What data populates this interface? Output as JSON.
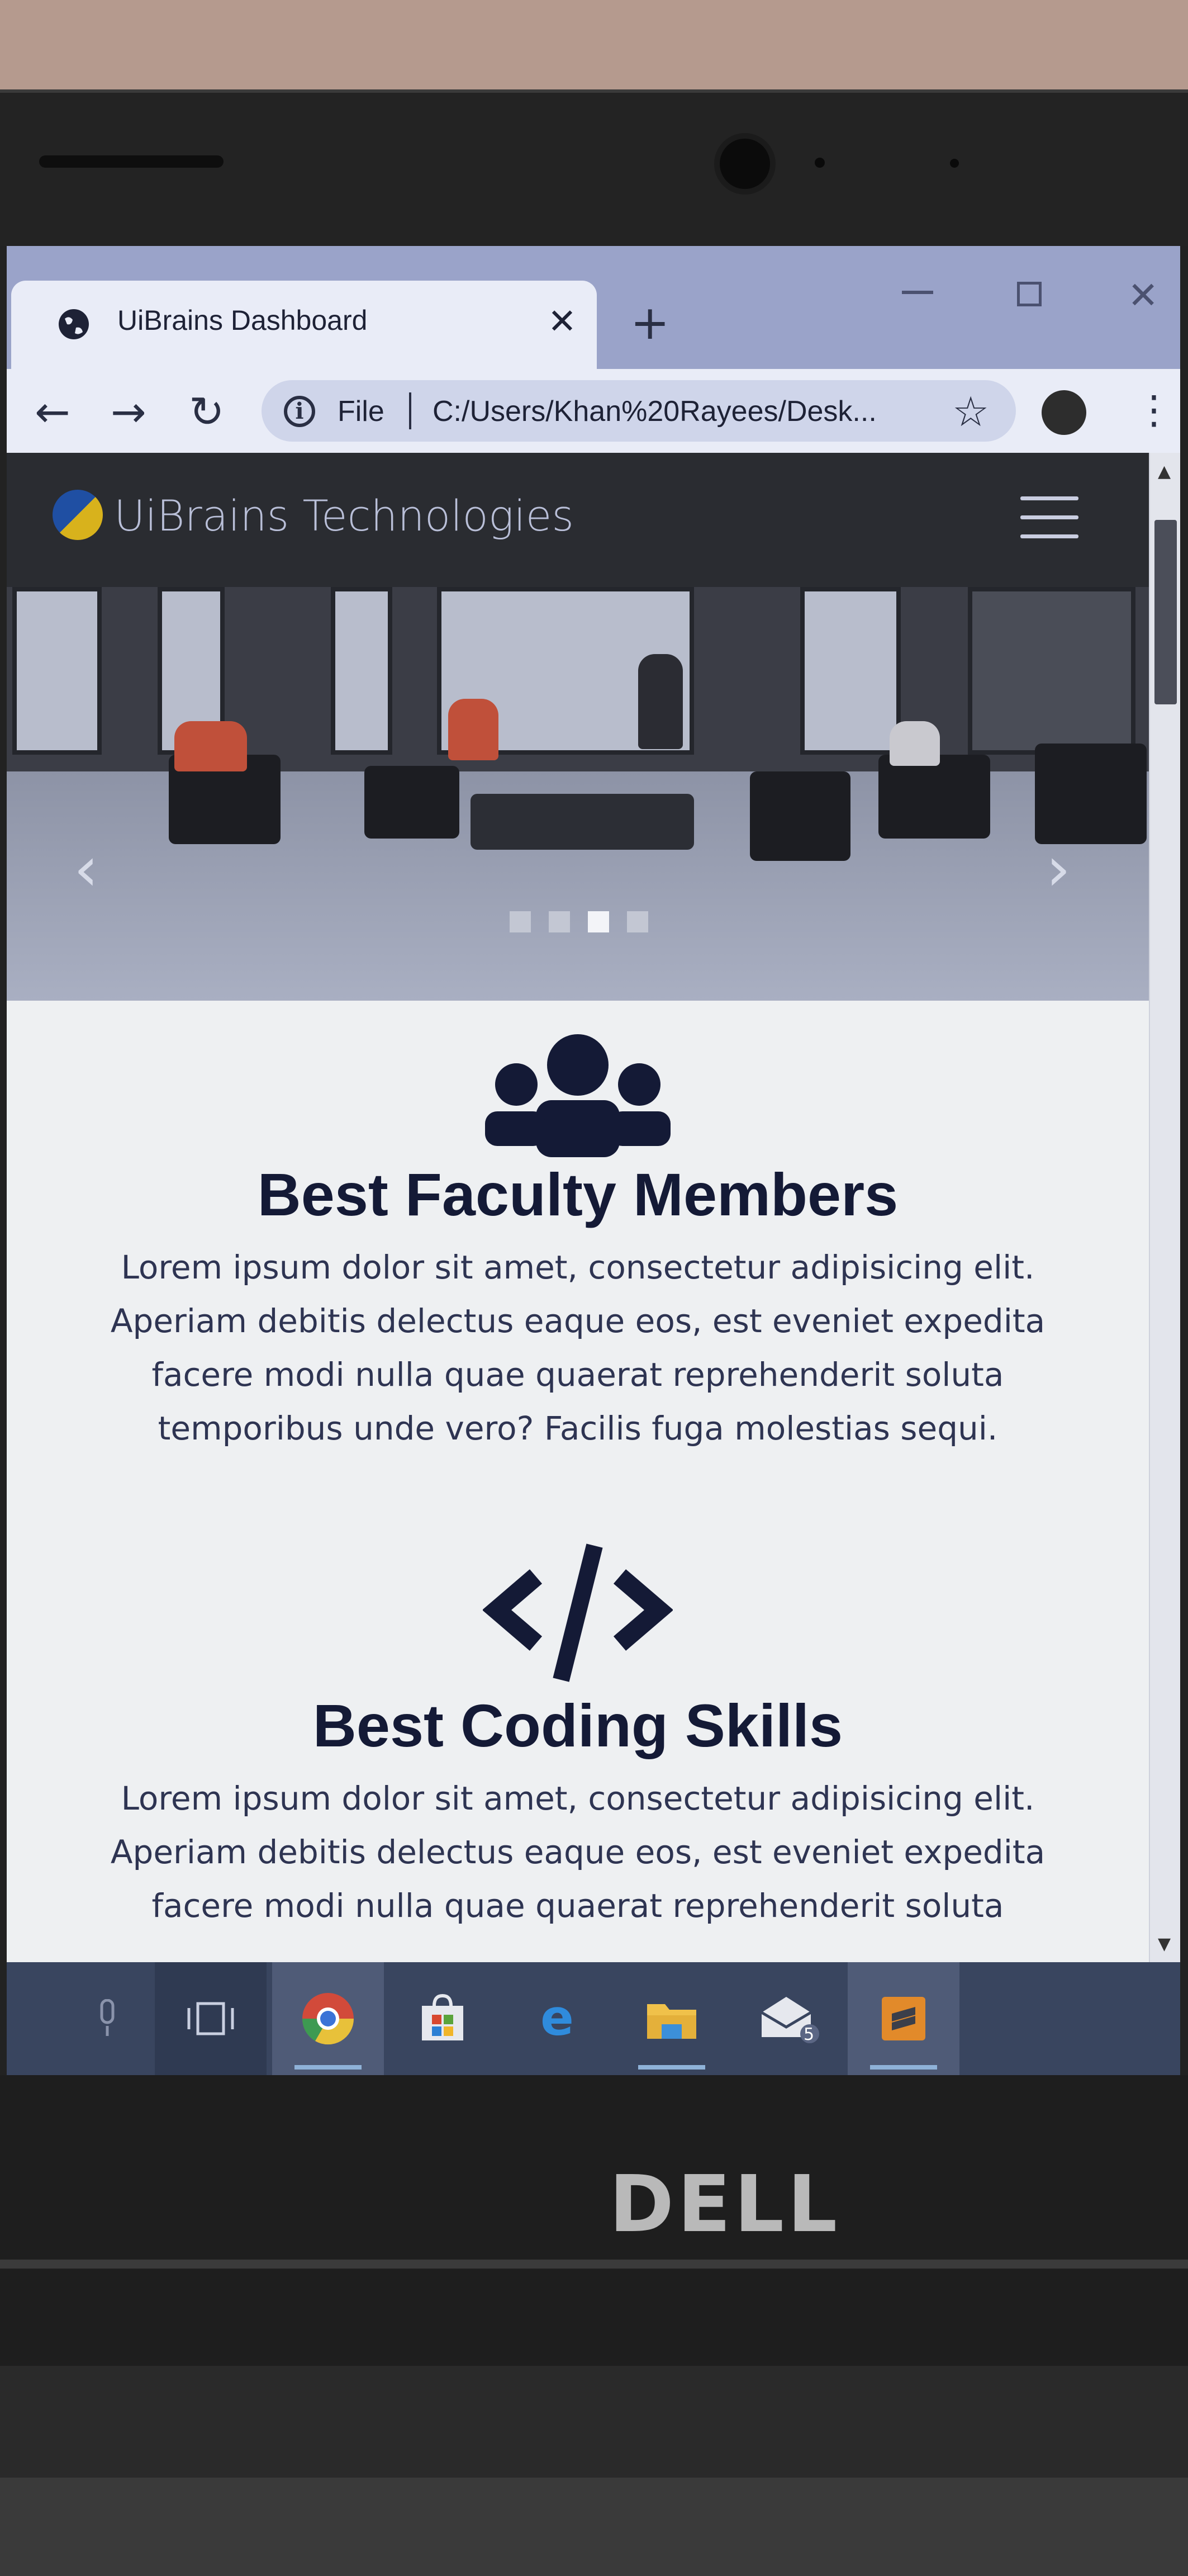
{
  "browser": {
    "tab_title": "UiBrains Dashboard",
    "tab_close": "✕",
    "new_tab": "+",
    "address_label": "File",
    "address_url": "C:/Users/Khan%20Rayees/Desk...",
    "icons": [
      "globe-icon",
      "back-arrow-icon",
      "forward-arrow-icon",
      "reload-icon",
      "info-icon",
      "star-icon",
      "extension-icon",
      "kebab-menu-icon"
    ]
  },
  "site": {
    "brand": "UiBrains Technologies",
    "carousel": {
      "slides_count": 4,
      "active_slide": 3,
      "prev_icon": "‹",
      "next_icon": "›"
    },
    "features": [
      {
        "icon": "users-icon",
        "title": "Best Faculty Members",
        "text": "Lorem ipsum dolor sit amet, consectetur adipisicing elit. Aperiam debitis delectus eaque eos, est eveniet expedita facere modi nulla quae quaerat reprehenderit soluta temporibus unde vero? Facilis fuga molestias sequi."
      },
      {
        "icon": "code-icon",
        "title": "Best Coding Skills",
        "text": "Lorem ipsum dolor sit amet, consectetur adipisicing elit. Aperiam debitis delectus eaque eos, est eveniet expedita facere modi nulla quae quaerat reprehenderit soluta"
      }
    ]
  },
  "taskbar": {
    "items": [
      "microphone-icon",
      "task-view-icon",
      "chrome-icon",
      "store-icon",
      "edge-icon",
      "file-explorer-icon",
      "mail-icon",
      "sublime-text-icon"
    ],
    "mail_badge": "5"
  },
  "device": {
    "brand": "DELL"
  },
  "colors": {
    "navbar": "#2a2c31",
    "heading": "#141a36",
    "taskbar": "#39455f"
  }
}
